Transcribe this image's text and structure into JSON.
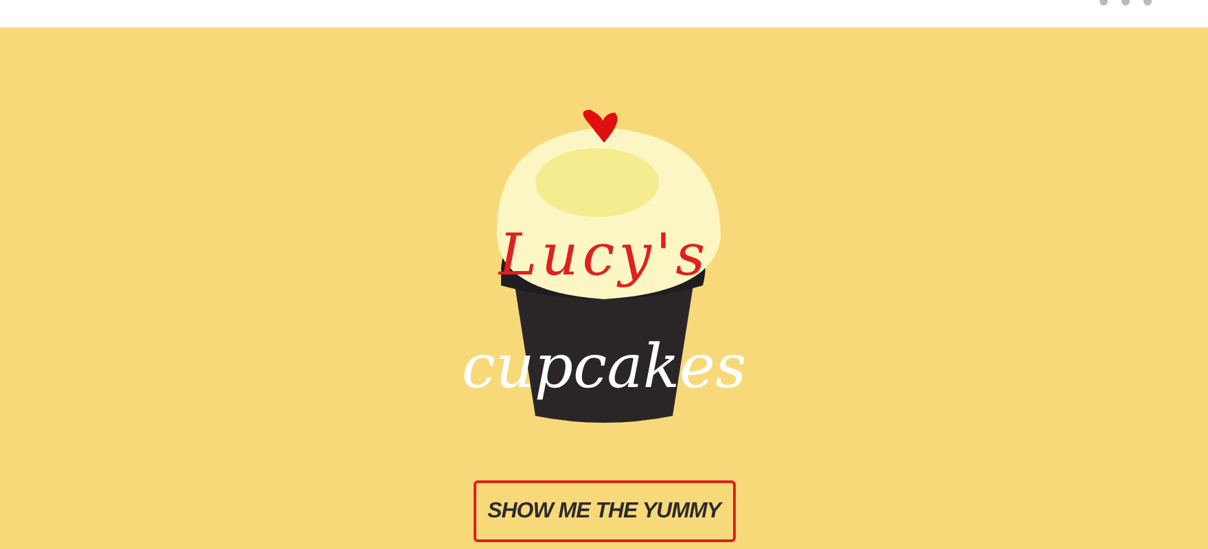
{
  "logo": {
    "top_word": "Lucy's",
    "bottom_word": "cupcakes"
  },
  "cta_button": {
    "label": "SHOW ME THE YUMMY"
  }
}
